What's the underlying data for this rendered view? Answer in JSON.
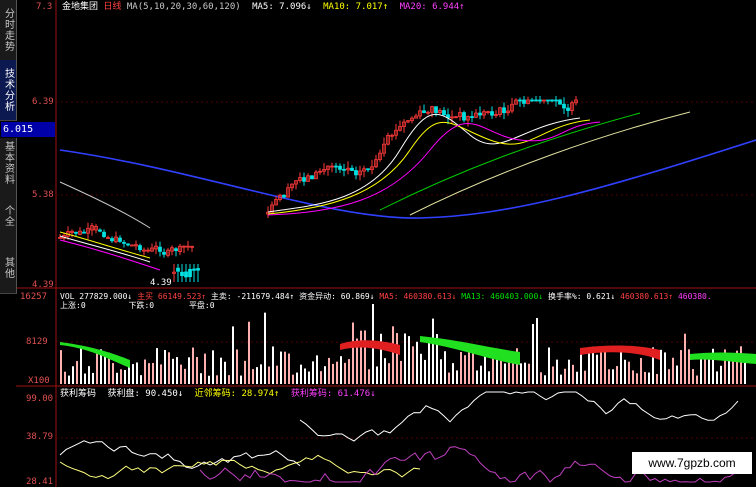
{
  "sidebar": {
    "tabs": [
      {
        "label": "分时走势",
        "active": false
      },
      {
        "label": "技术分析",
        "active": true
      },
      {
        "label": "基本资料",
        "active": false
      },
      {
        "label": "个全",
        "active": false
      },
      {
        "label": "其他",
        "active": false
      }
    ]
  },
  "price_axis": {
    "top": "7.3",
    "v1": "6.39",
    "current": "6.015",
    "v2": "5.38",
    "v3": "4.39"
  },
  "vol_axis": {
    "top": "16257",
    "mid": "8129",
    "unit": "X100"
  },
  "prof_axis": {
    "top": "99.00",
    "mid": "38.79",
    "bottom": "28.41"
  },
  "header_main": {
    "stock": "金地集团",
    "period": "日线",
    "ma_params": "MA(5,10,20,30,60,120)",
    "ma5": "MA5: 7.096↓",
    "ma10": "MA10: 7.017↑",
    "ma20": "MA20: 6.944↑"
  },
  "header_vol": {
    "vol": "VOL 277829.000↓",
    "a": "主买",
    "b": "66149.523↑",
    "c": "主卖: -211679.484↑",
    "d": "资金异动: 60.869↓",
    "e": "MA5: 460380.613↓",
    "f": "MA13: 460403.000↓",
    "g": "换手率%: 0.621↓",
    "h": "460380.613↑",
    "i": "460380.",
    "up": "上涨:0",
    "down": "下跌:0",
    "flat": "平盘:0"
  },
  "header_prof": {
    "name": "获利筹码",
    "p1": "获利盘: 90.450↓",
    "p2": "近邻筹码: 28.974↑",
    "p3": "获利筹码: 61.476↓"
  },
  "low_label": "4.39",
  "watermark": "www.7gpzb.com",
  "colors": {
    "up": "#ff3a3a",
    "down": "#00e0e0",
    "ma5": "#ffffff",
    "ma10": "#ffff00",
    "ma20": "#ff00ff",
    "ma60": "#00cc00",
    "ma120": "#3040ff",
    "profit": "#c040c0"
  }
}
